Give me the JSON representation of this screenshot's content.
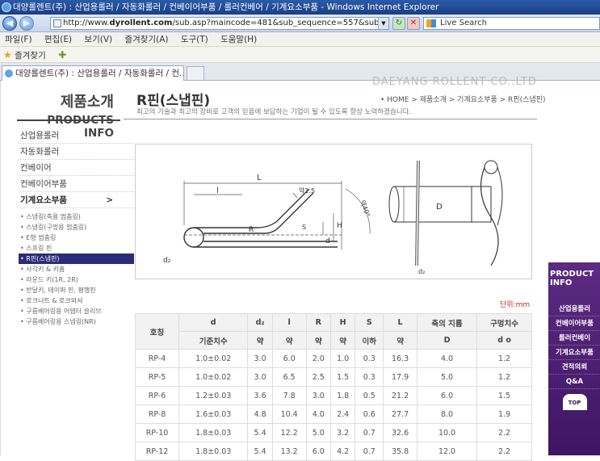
{
  "browser": {
    "title": "대양롤렌트(주) : 산업용롤러 / 자동화롤러 / 컨베이어부품 / 롤러컨베어 / 기계요소부품 - Windows Internet Explorer",
    "url_prefix": "http://www.",
    "url_domain": "dyrollent.com",
    "url_path": "/sub.asp?maincode=481&sub_sequence=557&sub_sequence",
    "search_placeholder": "Live Search",
    "menu": [
      "파일(F)",
      "편집(E)",
      "보기(V)",
      "즐겨찾기(A)",
      "도구(T)",
      "도움말(H)"
    ],
    "favorites_label": "즐겨찾기",
    "tab_title": "대양롤렌트(주) : 산업용롤러 / 자동화롤러 / 컨..."
  },
  "site": {
    "logo_text": "DAEYANG ROLLENT CO.,LTD",
    "section_title_ko": "제품소개",
    "section_title_en": "PRODUCTS INFO",
    "categories": [
      "산업용롤러",
      "자동화롤러",
      "컨베이어",
      "컨베이어부품",
      "기계요소부품"
    ],
    "active_category_arrow": ">",
    "subitems": [
      "스냅링(축용 멈춤링)",
      "스냅링(구멍용 멈춤링)",
      "E형 멈춤링",
      "스프링 핀",
      "R핀(스냅핀)",
      "사각키 & 키홈",
      "라운드 키(1R, 2R)",
      "반달키, 테이퍼 핀, 평행핀",
      "로크너트 & 로크와셔",
      "구름베어링용 어댑터 슬리브",
      "구름베어링용 스냅링(NR)"
    ]
  },
  "page": {
    "title": "R핀(스냅핀)",
    "breadcrumb": "• HOME > 제품소개 > 기계요소부품 > R핀(스냅핀)",
    "slogan": "최고의 기술과 최고의 장비로 고객의 믿음에 보답하는 기업이 될 수 있도록 항상 노력하겠습니다.",
    "unit": "단위:mm"
  },
  "diagram_labels": {
    "L": "L",
    "l": "l",
    "bend": "약1.5",
    "angle": "약40°",
    "R": "R",
    "S": "S",
    "H": "H",
    "d": "d",
    "d2": "d₂",
    "D": "D",
    "d2b": "d₂"
  },
  "table": {
    "header_row1": [
      "호칭",
      "d",
      "d₂",
      "l",
      "R",
      "H",
      "S",
      "L",
      "축의 지름",
      "구멍치수"
    ],
    "header_row2": [
      "기준치수",
      "약",
      "약",
      "약",
      "약",
      "이하",
      "약",
      "D",
      "d o"
    ],
    "rows": [
      [
        "RP-4",
        "1.0±0.02",
        "3.0",
        "6.0",
        "2.0",
        "1.0",
        "0.3",
        "16.3",
        "4.0",
        "1.2"
      ],
      [
        "RP-5",
        "1.0±0.02",
        "3.0",
        "6.5",
        "2.5",
        "1.5",
        "0.3",
        "17.9",
        "5.0",
        "1.2"
      ],
      [
        "RP-6",
        "1.2±0.03",
        "3.6",
        "7.8",
        "3.0",
        "1.8",
        "0.5",
        "21.2",
        "6.0",
        "1.5"
      ],
      [
        "RP-8",
        "1.6±0.03",
        "4.8",
        "10.4",
        "4.0",
        "2.4",
        "0.6",
        "27.7",
        "8.0",
        "1.9"
      ],
      [
        "RP-10",
        "1.8±0.03",
        "5.4",
        "12.2",
        "5.0",
        "3.2",
        "0.7",
        "32.6",
        "10.0",
        "2.2"
      ],
      [
        "RP-12",
        "1.8±0.03",
        "5.4",
        "13.2",
        "6.0",
        "4.2",
        "0.7",
        "35.8",
        "12.0",
        "2.2"
      ]
    ]
  },
  "right_nav": {
    "title": "PRODUCT INFO",
    "items": [
      "산업용롤러",
      "컨베이어부품",
      "롤러컨베이",
      "기계요소부품",
      "견적의뢰",
      "Q&A"
    ],
    "top": "TOP"
  },
  "colors": {
    "titlebar": "#1a3f86",
    "active_sub": "#2b2b7a",
    "right_nav": "#3e1563",
    "unit": "#d42020"
  }
}
